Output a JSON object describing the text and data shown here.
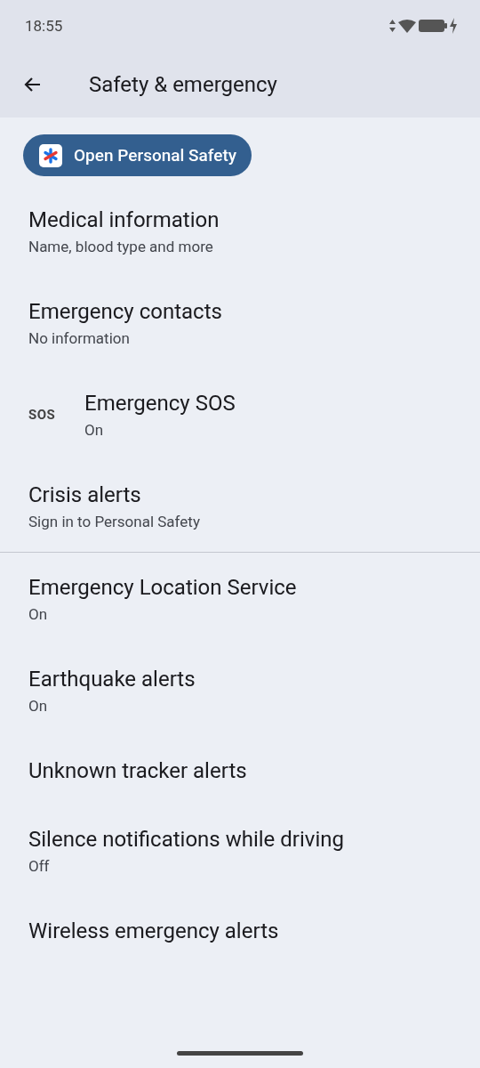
{
  "status_bar": {
    "time": "18:55"
  },
  "app_bar": {
    "title": "Safety & emergency"
  },
  "action_button": {
    "label": "Open Personal Safety"
  },
  "sections": [
    {
      "items": [
        {
          "title": "Medical information",
          "subtitle": "Name, blood type and more"
        },
        {
          "title": "Emergency contacts",
          "subtitle": "No information"
        },
        {
          "title": "Emergency SOS",
          "subtitle": "On",
          "icon_text": "SOS"
        },
        {
          "title": "Crisis alerts",
          "subtitle": "Sign in to Personal Safety"
        }
      ]
    },
    {
      "items": [
        {
          "title": "Emergency Location Service",
          "subtitle": "On"
        },
        {
          "title": "Earthquake alerts",
          "subtitle": "On"
        },
        {
          "title": "Unknown tracker alerts"
        },
        {
          "title": "Silence notifications while driving",
          "subtitle": "Off"
        },
        {
          "title": "Wireless emergency alerts"
        }
      ]
    }
  ]
}
